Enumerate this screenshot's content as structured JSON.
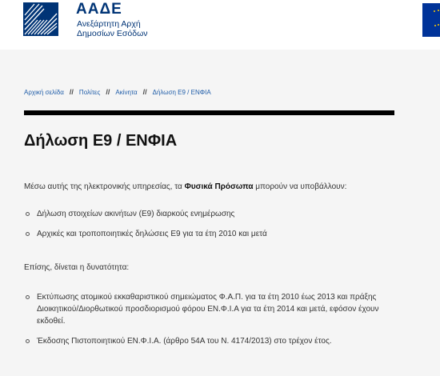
{
  "header": {
    "logo_abbr": "ΑΑΔΕ",
    "logo_line1": "Ανεξάρτητη Αρχή",
    "logo_line2": "Δημοσίων Εσόδων"
  },
  "breadcrumb": {
    "items": [
      "Αρχική σελίδα",
      "Πολίτες",
      "Ακίνητα",
      "Δήλωση Ε9 / ΕΝΦΙΑ"
    ],
    "separator": "//"
  },
  "page": {
    "title": "Δήλωση Ε9 / ΕΝΦΙΑ",
    "intro_prefix": "Μέσω αυτής της ηλεκτρονικής υπηρεσίας, τα ",
    "intro_bold": "Φυσικά Πρόσωπα",
    "intro_suffix": " μπορούν να υποβάλλουν:",
    "submit_items": [
      "Δήλωση στοιχείων ακινήτων (Ε9) διαρκούς ενημέρωσης",
      "Αρχικές και τροποποιητικές δηλώσεις Ε9 για τα έτη 2010 και μετά"
    ],
    "also_text": "Επίσης, δίνεται η δυνατότητα:",
    "also_items": [
      "Εκτύπωσης ατομικού εκκαθαριστικού σημειώματος Φ.Α.Π. για τα έτη 2010 έως 2013 και πράξης Διοικητικού/Διορθωτικού προσδιορισμού φόρου ΕΝ.Φ.Ι.Α για τα έτη  2014 και μετά, εφόσον έχουν εκδοθεί.",
      "Έκδοσης Πιστοποιητικού ΕΝ.Φ.Ι.Α. (άρθρο 54Α του Ν. 4174/2013) στο τρέχον έτος."
    ]
  },
  "colors": {
    "brand_blue": "#003476",
    "link_blue": "#1e5ca8",
    "eu_blue": "#003399",
    "eu_star": "#ffcc00"
  },
  "icons": {
    "logo": "aade-logo-icon",
    "flag": "eu-flag-icon"
  }
}
